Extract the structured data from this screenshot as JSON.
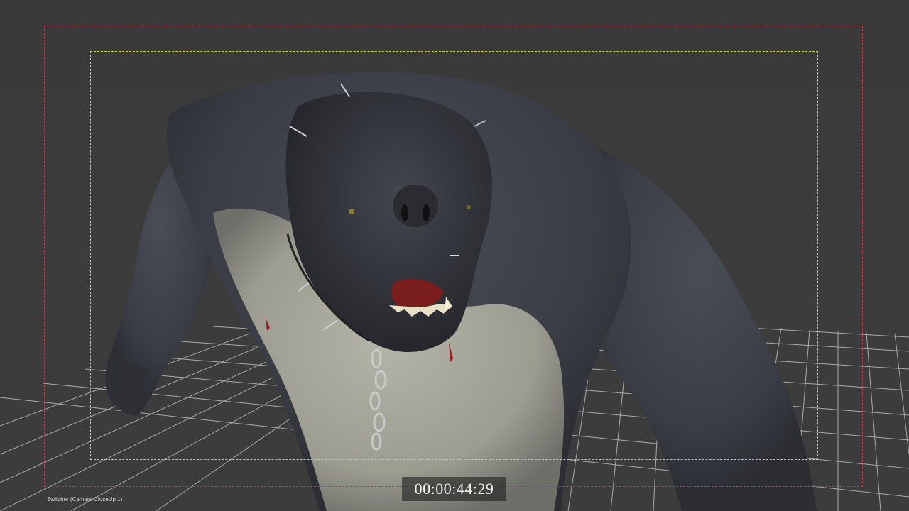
{
  "viewport": {
    "background_color": "#3b3b3b",
    "grid_color": "#bdbdbd",
    "creature_skin_color": "#3d4048",
    "creature_belly_color": "#a9a89c"
  },
  "overlays": {
    "action_safe_color": "#c23a4a",
    "title_safe_color": "#d9d24a"
  },
  "hud": {
    "timecode": "00:00:44:29",
    "switcher_label": "Switcher (Camera CloseUp 1)"
  },
  "icons": {
    "crosshair": "crosshair-icon"
  }
}
